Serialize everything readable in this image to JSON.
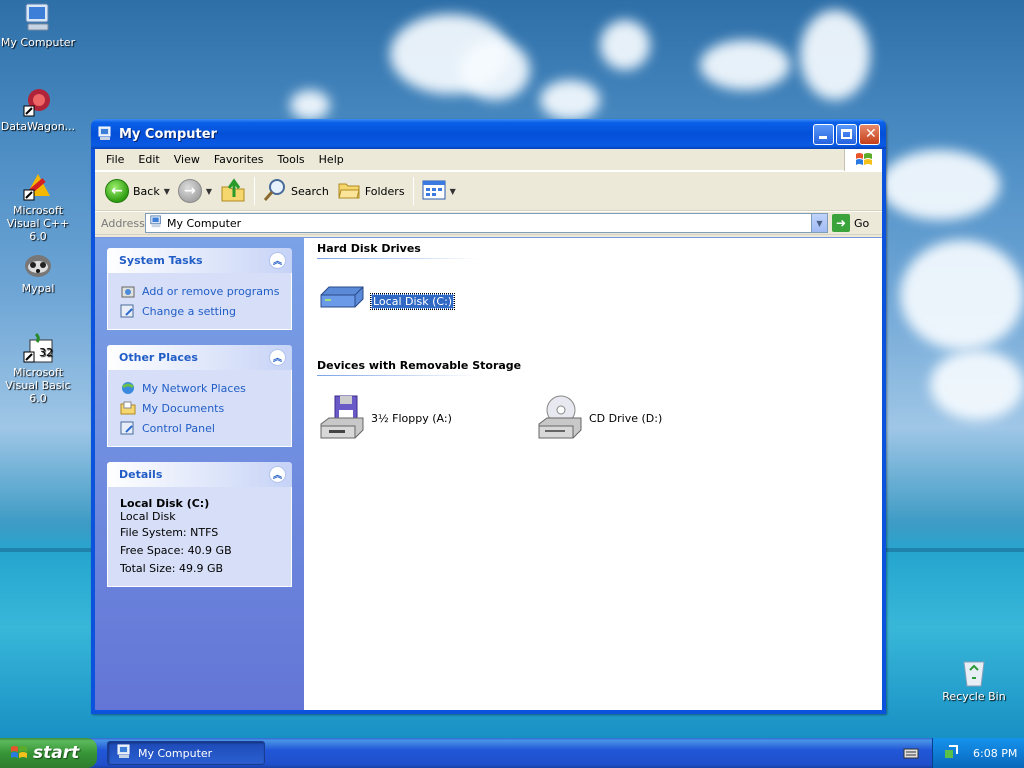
{
  "desktop": {
    "icons": [
      {
        "label": "My Computer"
      },
      {
        "label": "DataWagon..."
      },
      {
        "label": "Microsoft Visual C++ 6.0"
      },
      {
        "label": "Mypal"
      },
      {
        "label": "Microsoft Visual Basic 6.0"
      },
      {
        "label": "Recycle Bin"
      }
    ]
  },
  "window": {
    "title": "My Computer",
    "menu": [
      "File",
      "Edit",
      "View",
      "Favorites",
      "Tools",
      "Help"
    ],
    "toolbar": {
      "back": "Back",
      "search": "Search",
      "folders": "Folders"
    },
    "address": {
      "label": "Address",
      "value": "My Computer",
      "go": "Go"
    },
    "left_pane": {
      "system_tasks": {
        "title": "System Tasks",
        "items": [
          "Add or remove programs",
          "Change a setting"
        ]
      },
      "other_places": {
        "title": "Other Places",
        "items": [
          "My Network Places",
          "My Documents",
          "Control Panel"
        ]
      },
      "details": {
        "title": "Details",
        "name": "Local Disk (C:)",
        "type": "Local Disk",
        "file_system": "File System: NTFS",
        "free_space": "Free Space: 40.9 GB",
        "total_size": "Total Size: 49.9 GB"
      }
    },
    "main": {
      "groups": [
        {
          "title": "Hard Disk Drives",
          "items": [
            {
              "label": "Local Disk (C:)",
              "selected": true
            }
          ]
        },
        {
          "title": "Devices with Removable Storage",
          "items": [
            {
              "label": "3½ Floppy (A:)"
            },
            {
              "label": "CD Drive (D:)"
            }
          ]
        }
      ]
    }
  },
  "taskbar": {
    "start": "start",
    "task": "My Computer",
    "clock": "6:08 PM"
  },
  "colors": {
    "titlebar": "#0a5ae4",
    "taskpane_link": "#215dc6",
    "selection": "#316ac5",
    "start_green": "#379537"
  }
}
